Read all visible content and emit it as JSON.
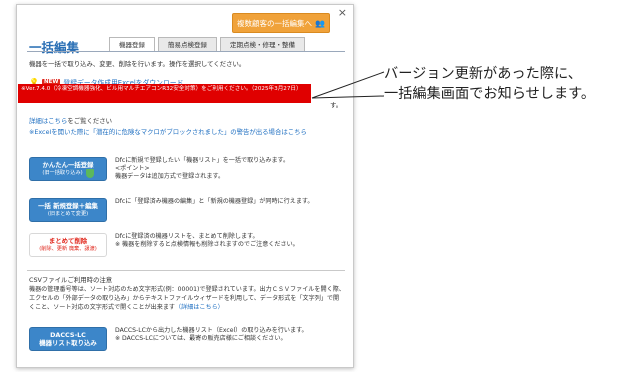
{
  "dialog": {
    "close_label": "×",
    "bulk_button_label": "複数顧客の一括編集へ",
    "title": "一括編集",
    "tabs": [
      {
        "label": "機器登録",
        "active": true
      },
      {
        "label": "簡易点検登録",
        "active": false
      },
      {
        "label": "定期点検・修理・整備",
        "active": false
      }
    ],
    "description": "機器を一括で取り込み、変更、削除を行います。操作を選択してください。",
    "new_badge": "NEW",
    "new_link": "登録データ作成用Excelをダウンロード",
    "red_banner": "※Ver.7.4.0（冷凍空調機器強化、ビル用マルチエアコンR32安全対策）をご利用ください。（2025年3月27日）",
    "partial_tail_text": "す。",
    "detail_link": "詳細はこちら",
    "detail_tail": "をご覧ください",
    "macro_link": "※Excelを開いた際に「潜在的に危険なマクロがブロックされました」の警告が出る場合はこちら",
    "actions": [
      {
        "line1": "かんたん一括登録",
        "line2": "(旧一括取り込み)",
        "desc": "Dfcに新規で登録したい「機器リスト」を一括で取り込みます。\n<ポイント>\n機器データは追加方式で登録されます。"
      },
      {
        "line1": "一括 新規登録＋編集",
        "line2": "(旧まとめて変更)",
        "desc": "Dfcに「登録済み機器の編集」と「新規の機器登録」が同時に行えます。"
      },
      {
        "line1": "まとめて削除",
        "line2": "(削除、更新 廃棄、譲渡)",
        "desc": "Dfcに登録済の機器リストを、まとめて削除します。\n※ 機器を削除すると点検情報も削除されますのでご注意ください。"
      }
    ],
    "csv_title": "CSVファイルご利用時の注意",
    "csv_text": "機器の管理番号等は、ソート対応のため文字形式(例：00001)で登録されています。出力ＣＳＶファイルを開く際、エクセルの「外部データの取り込み」からテキストファイルウィザードを利用して、データ形式を「文字列」で開くこと、ソート対応の文字形式で開くことが出来ます",
    "csv_link": "（詳細はこちら）",
    "daccs": {
      "line1": "DACCS-LC",
      "line2": "機器リスト取り込み",
      "desc": "DACCS-LCから出力した機器リスト（Excel）の取り込みを行います。\n※ DACCS-LCについては、最寄の販売店様にご相談ください。"
    }
  },
  "annotation": {
    "line1": "バージョン更新があった際に、",
    "line2": "一括編集画面でお知らせします。"
  },
  "colors": {
    "accent_blue": "#3c86c9",
    "banner_red": "#e00000",
    "orange": "#f0a23a"
  }
}
